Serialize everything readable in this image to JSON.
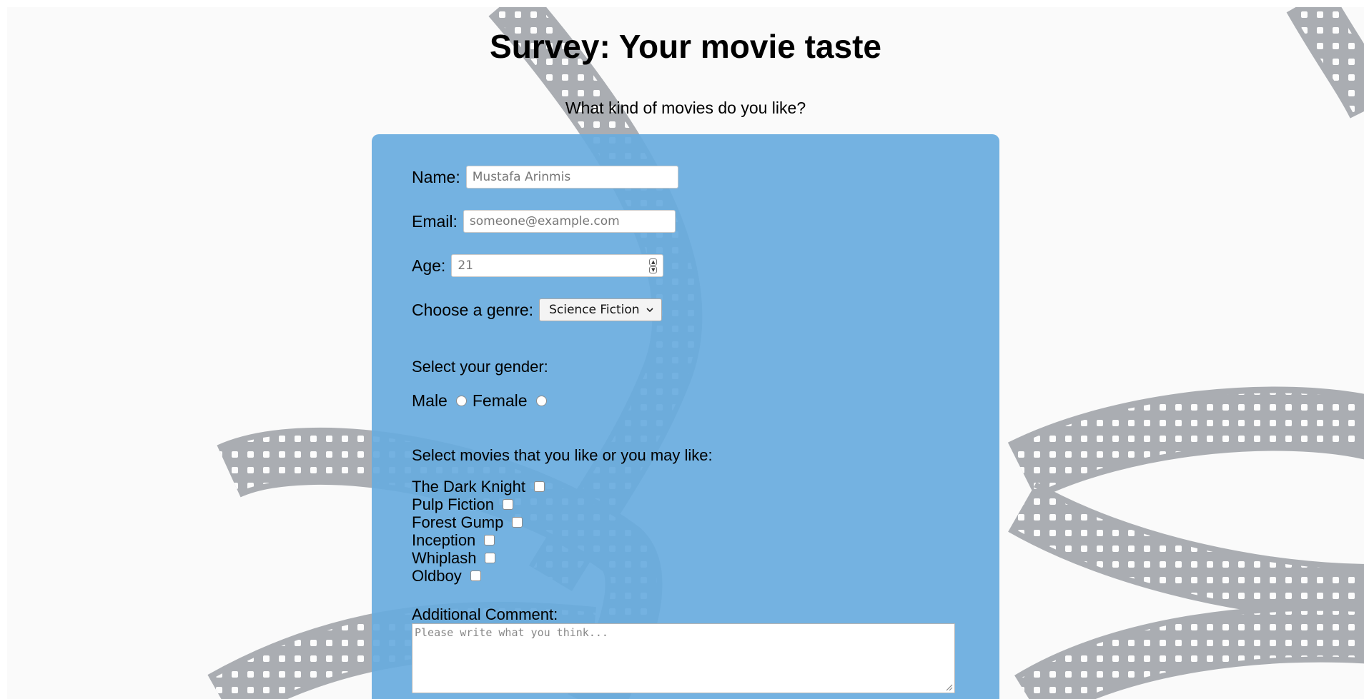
{
  "page": {
    "title": "Survey: Your movie taste",
    "subtitle": "What kind of movies do you like?"
  },
  "form": {
    "name": {
      "label": "Name:",
      "placeholder": "Mustafa Arinmis"
    },
    "email": {
      "label": "Email:",
      "placeholder": "someone@example.com"
    },
    "age": {
      "label": "Age:",
      "placeholder": "21"
    },
    "genre": {
      "label": "Choose a genre:",
      "selected": "Science Fiction"
    },
    "gender": {
      "heading": "Select your gender:",
      "options": [
        "Male",
        "Female"
      ]
    },
    "movies": {
      "heading": "Select movies that you like or you may like:",
      "options": [
        "The Dark Knight",
        "Pulp Fiction",
        "Forest Gump",
        "Inception",
        "Whiplash",
        "Oldboy"
      ]
    },
    "comment": {
      "label": "Additional Comment:",
      "placeholder": "Please write what you think..."
    }
  },
  "colors": {
    "card": "#68abde",
    "background": "#fafafa"
  },
  "icons": {
    "genre_dropdown": "chevron-down-icon",
    "age_spinner": "spinner-arrows-icon",
    "textarea_resize": "resize-handle-icon",
    "background": "film-strip-decoration"
  }
}
